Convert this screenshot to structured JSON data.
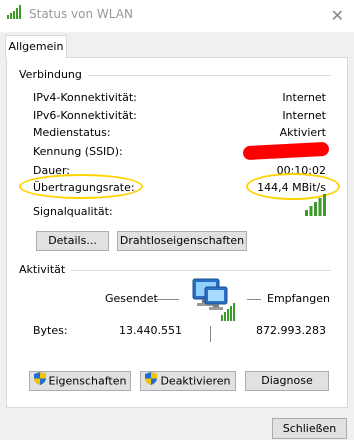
{
  "window": {
    "title": "Status von WLAN",
    "close_label": "✕"
  },
  "tabs": [
    {
      "label": "Allgemein"
    }
  ],
  "connection": {
    "group_label": "Verbindung",
    "rows": [
      {
        "label": "IPv4-Konnektivität:",
        "value": "Internet"
      },
      {
        "label": "IPv6-Konnektivität:",
        "value": "Internet"
      },
      {
        "label": "Medienstatus:",
        "value": "Aktiviert"
      },
      {
        "label": "Kennung (SSID):",
        "value": ""
      },
      {
        "label": "Dauer:",
        "value": "00:10:02"
      },
      {
        "label": "Übertragungsrate:",
        "value": "144,4 MBit/s"
      }
    ],
    "signal_label": "Signalqualität:",
    "signal_bars": 5,
    "signal_bars_max": 5,
    "details_button": "Details...",
    "wireless_props_button": "Drahtloseigenschaften"
  },
  "activity": {
    "group_label": "Aktivität",
    "sent_label": "Gesendet",
    "received_label": "Empfangen",
    "bytes_label": "Bytes:",
    "bytes_sent": "13.440.551",
    "bytes_received": "872.993.283"
  },
  "actions": {
    "properties_button": "Eigenschaften",
    "deactivate_button": "Deaktivieren",
    "diagnose_button": "Diagnose"
  },
  "footer": {
    "close_button": "Schließen"
  },
  "colors": {
    "signal_green": "#3a9a2a",
    "highlight_yellow": "#ffd400",
    "redaction_red": "#ff0000",
    "shield_blue": "#1e6fd0",
    "shield_yellow": "#f5c400"
  }
}
